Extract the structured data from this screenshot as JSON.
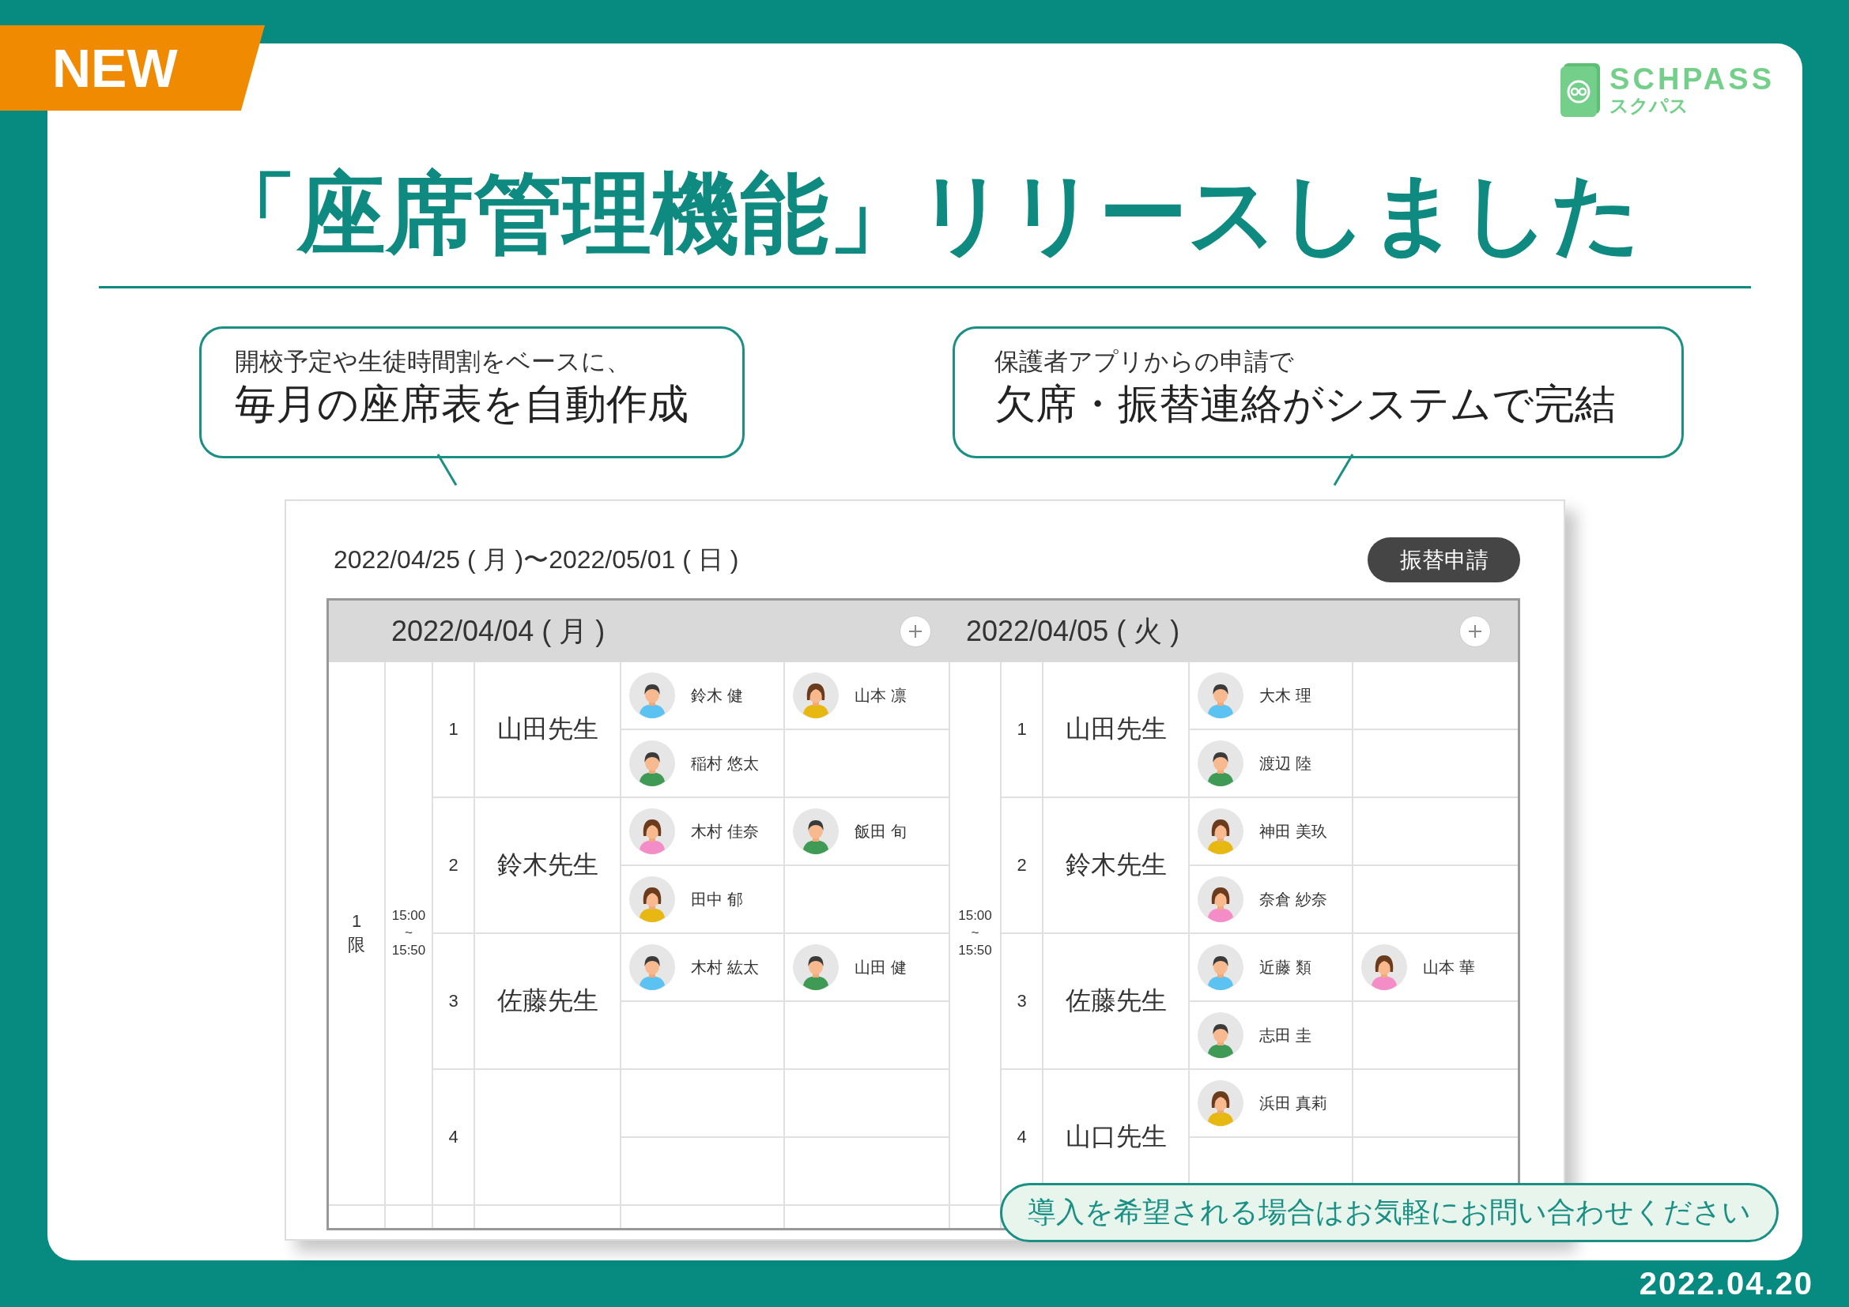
{
  "badge": "NEW",
  "logo": {
    "name": "SCHPASS",
    "kana": "スクパス"
  },
  "title": "「座席管理機能」リリースしました",
  "callouts": [
    {
      "caption": "開校予定や生徒時間割をベースに、",
      "headline": "毎月の座席表を自動作成"
    },
    {
      "caption": "保護者アプリからの申請で",
      "headline": "欠席・振替連絡がシステムで完結"
    }
  ],
  "schedule": {
    "range": "2022/04/25 ( 月 )〜2022/05/01 ( 日 )",
    "button": "振替申請",
    "days": [
      {
        "date": "2022/04/04 ( 月 )",
        "period": "1限",
        "time": "15:00\n~\n15:50",
        "classes": [
          {
            "number": "1",
            "teacher": "山田先生",
            "seats": [
              [
                {
                  "name": "鈴木 健",
                  "kind": "boy",
                  "color": "#5bc2f2"
                },
                {
                  "name": "山本 凛",
                  "kind": "girl",
                  "color": "#e8b812"
                }
              ],
              [
                {
                  "name": "稲村 悠太",
                  "kind": "boy",
                  "color": "#3f9a55"
                }
              ]
            ]
          },
          {
            "number": "2",
            "teacher": "鈴木先生",
            "seats": [
              [
                {
                  "name": "木村 佳奈",
                  "kind": "girl",
                  "color": "#f48cc8"
                },
                {
                  "name": "飯田 旬",
                  "kind": "boy",
                  "color": "#3f9a55"
                }
              ],
              [
                {
                  "name": "田中 郁",
                  "kind": "girl",
                  "color": "#e8b812"
                }
              ]
            ]
          },
          {
            "number": "3",
            "teacher": "佐藤先生",
            "seats": [
              [
                {
                  "name": "木村 紘太",
                  "kind": "boy",
                  "color": "#5bc2f2"
                },
                {
                  "name": "山田 健",
                  "kind": "boy",
                  "color": "#3f9a55"
                }
              ]
            ]
          },
          {
            "number": "4"
          }
        ]
      },
      {
        "date": "2022/04/05 ( 火 )",
        "time": "15:00\n~\n15:50",
        "classes": [
          {
            "number": "1",
            "teacher": "山田先生",
            "seats": [
              [
                {
                  "name": "大木 理",
                  "kind": "boy",
                  "color": "#5bc2f2"
                }
              ],
              [
                {
                  "name": "渡辺 陸",
                  "kind": "boy",
                  "color": "#3f9a55"
                }
              ]
            ]
          },
          {
            "number": "2",
            "teacher": "鈴木先生",
            "seats": [
              [
                {
                  "name": "神田 美玖",
                  "kind": "girl",
                  "color": "#e8b812"
                }
              ],
              [
                {
                  "name": "奈倉 紗奈",
                  "kind": "girl",
                  "color": "#f48cc8"
                }
              ]
            ]
          },
          {
            "number": "3",
            "teacher": "佐藤先生",
            "seats": [
              [
                {
                  "name": "近藤 類",
                  "kind": "boy",
                  "color": "#5bc2f2"
                },
                {
                  "name": "山本 華",
                  "kind": "girl",
                  "color": "#f48cc8"
                }
              ],
              [
                {
                  "name": "志田 圭",
                  "kind": "boy",
                  "color": "#3f9a55"
                }
              ]
            ]
          },
          {
            "number": "4",
            "teacher": "山口先生",
            "seats": [
              [
                {
                  "name": "浜田 真莉",
                  "kind": "girl",
                  "color": "#e8b812"
                }
              ]
            ]
          }
        ]
      }
    ]
  },
  "notice": "導入を希望される場合はお気軽にお問い合わせください",
  "date": "2022.04.20"
}
